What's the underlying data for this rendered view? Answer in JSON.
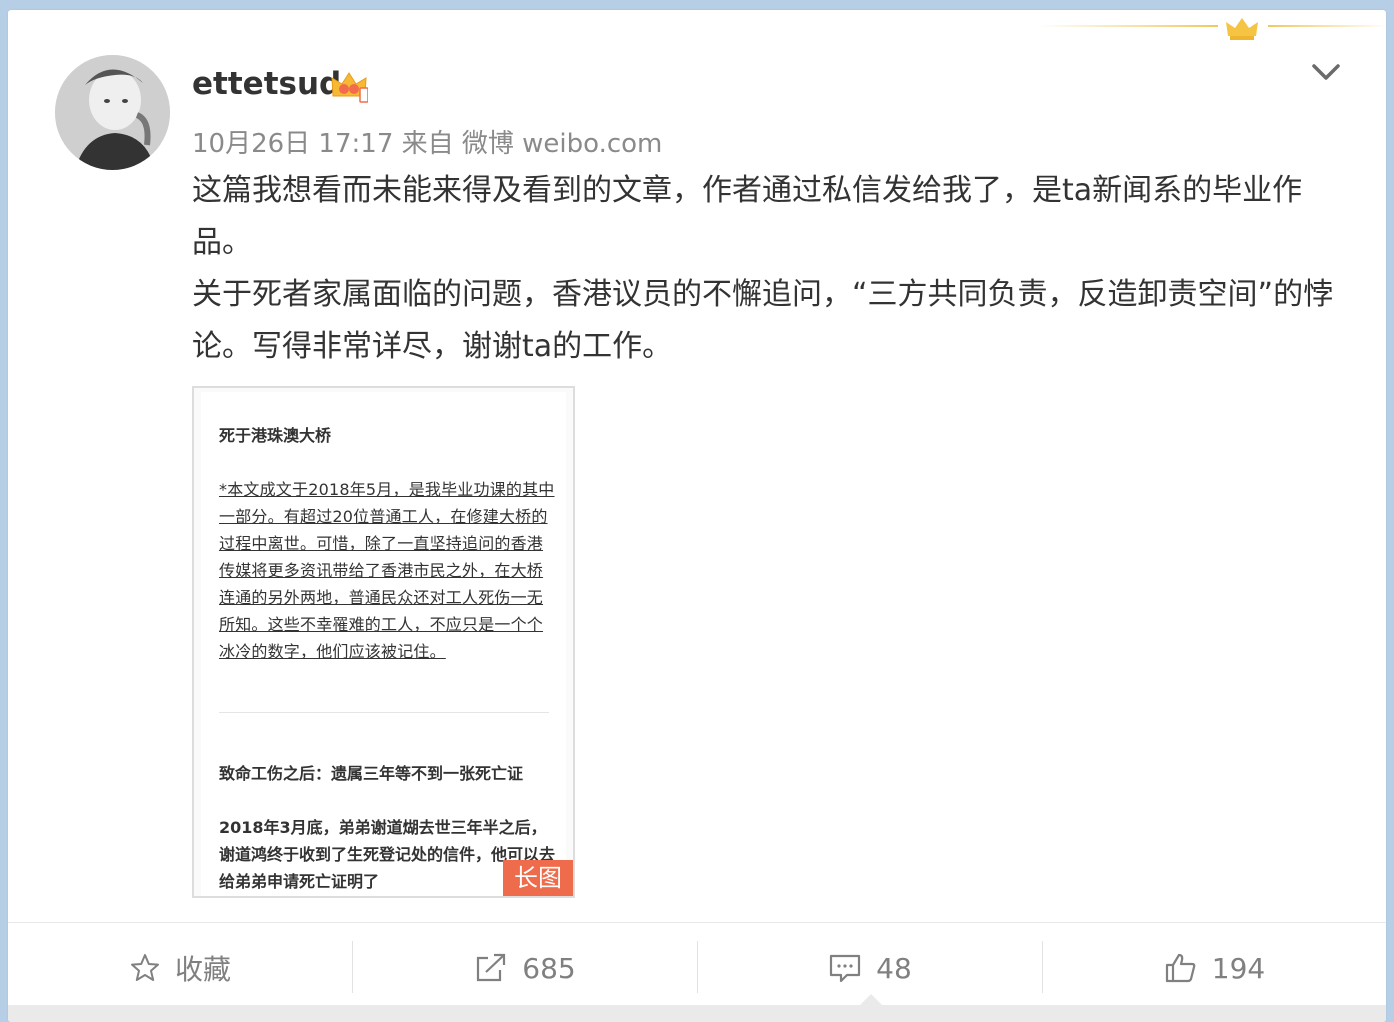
{
  "post": {
    "username": "ettetsud",
    "meta": "10月26日 17:17 来自 微博 weibo.com",
    "text_line1": "这篇我想看而未能来得及看到的文章，作者通过私信发给我了，是ta新闻系的毕业作品。",
    "text_line2": "关于死者家属面临的问题，香港议员的不懈追问，“三方共同负责，反造卸责空间”的悖论。写得非常详尽，谢谢ta的工作。"
  },
  "image": {
    "title": "死于港珠澳大桥",
    "intro": "*本文成文于2018年5月，是我毕业功课的其中一部分。有超过20位普通工人，在修建大桥的过程中离世。可惜，除了一直坚持追问的香港传媒将更多资讯带给了香港市民之外，在大桥连通的另外两地，普通民众还对工人死伤一无所知。这些不幸罹难的工人，不应只是一个个冰冷的数字，他们应该被记住。",
    "heading2": "致命工伤之后：遗属三年等不到一张死亡证",
    "body2": "2018年3月底，弟弟谢道煳去世三年半之后，谢道鸿终于收到了生死登记处的信件，他可以去给弟弟申请死亡证明了",
    "badge": "长图"
  },
  "actions": {
    "favorite_label": "收藏",
    "repost_count": "685",
    "comment_count": "48",
    "like_count": "194"
  },
  "icons": {
    "favorite": "star-icon",
    "repost": "share-icon",
    "comment": "comment-icon",
    "like": "thumbs-up-icon",
    "expand": "chevron-down-icon",
    "vip": "crown-icon"
  },
  "colors": {
    "background": "#b7cfe6",
    "badge": "#ee6c4b",
    "meta_text": "#8a8a8a"
  }
}
